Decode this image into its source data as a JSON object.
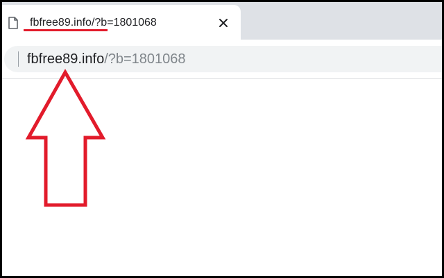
{
  "tab": {
    "title_host": "fbfree89.info",
    "title_rest": "/?b=1801068",
    "favicon": "page-icon",
    "close": "close-icon"
  },
  "omnibox": {
    "host": "fbfree89.info",
    "rest": "/?b=1801068"
  },
  "annotations": {
    "underline_color": "#e21b2b",
    "arrow_color": "#e21b2b",
    "arrow_direction": "up"
  }
}
